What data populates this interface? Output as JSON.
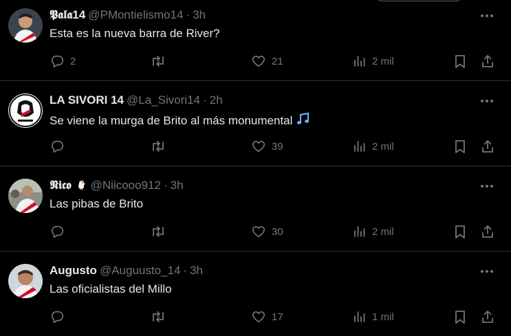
{
  "icons": {
    "more": "more-horizontal-icon",
    "reply": "reply-icon",
    "retweet": "retweet-icon",
    "like": "like-icon",
    "views": "views-icon",
    "bookmark": "bookmark-icon",
    "share": "share-icon",
    "note_emoji": "musical-notes-icon",
    "rooster_emoji": "rooster-icon"
  },
  "colors": {
    "background": "#000000",
    "text": "#e7e9ea",
    "muted": "#71767b",
    "divider": "#2f3336",
    "note": "#6fb6ff"
  },
  "tweets": [
    {
      "name": "𝕻𝖆𝖑𝖆14",
      "handle": "@PMontielismo14",
      "dot": "·",
      "time": "3h",
      "text": "Esta es la nueva barra de River?",
      "replies": "2",
      "retweets": "",
      "likes": "21",
      "views": "2 mil"
    },
    {
      "name": "LA SIVORI 14",
      "handle": "@La_Sivori14",
      "dot": "·",
      "time": "2h",
      "text": "Se viene la murga de Brito al más monumental",
      "replies": "",
      "retweets": "",
      "likes": "39",
      "views": "2 mil"
    },
    {
      "name": "𝕹𝖎𝖈𝖔",
      "emoji": "🐔",
      "handle": "@Niicooo912",
      "dot": "·",
      "time": "3h",
      "text": "Las pibas de Brito",
      "replies": "",
      "retweets": "",
      "likes": "30",
      "views": "2 mil"
    },
    {
      "name": "Augusto",
      "handle": "@Auguusto_14",
      "dot": "·",
      "time": "3h",
      "text": "Las oficialistas del Millo",
      "replies": "",
      "retweets": "",
      "likes": "17",
      "views": "1 mil"
    }
  ]
}
